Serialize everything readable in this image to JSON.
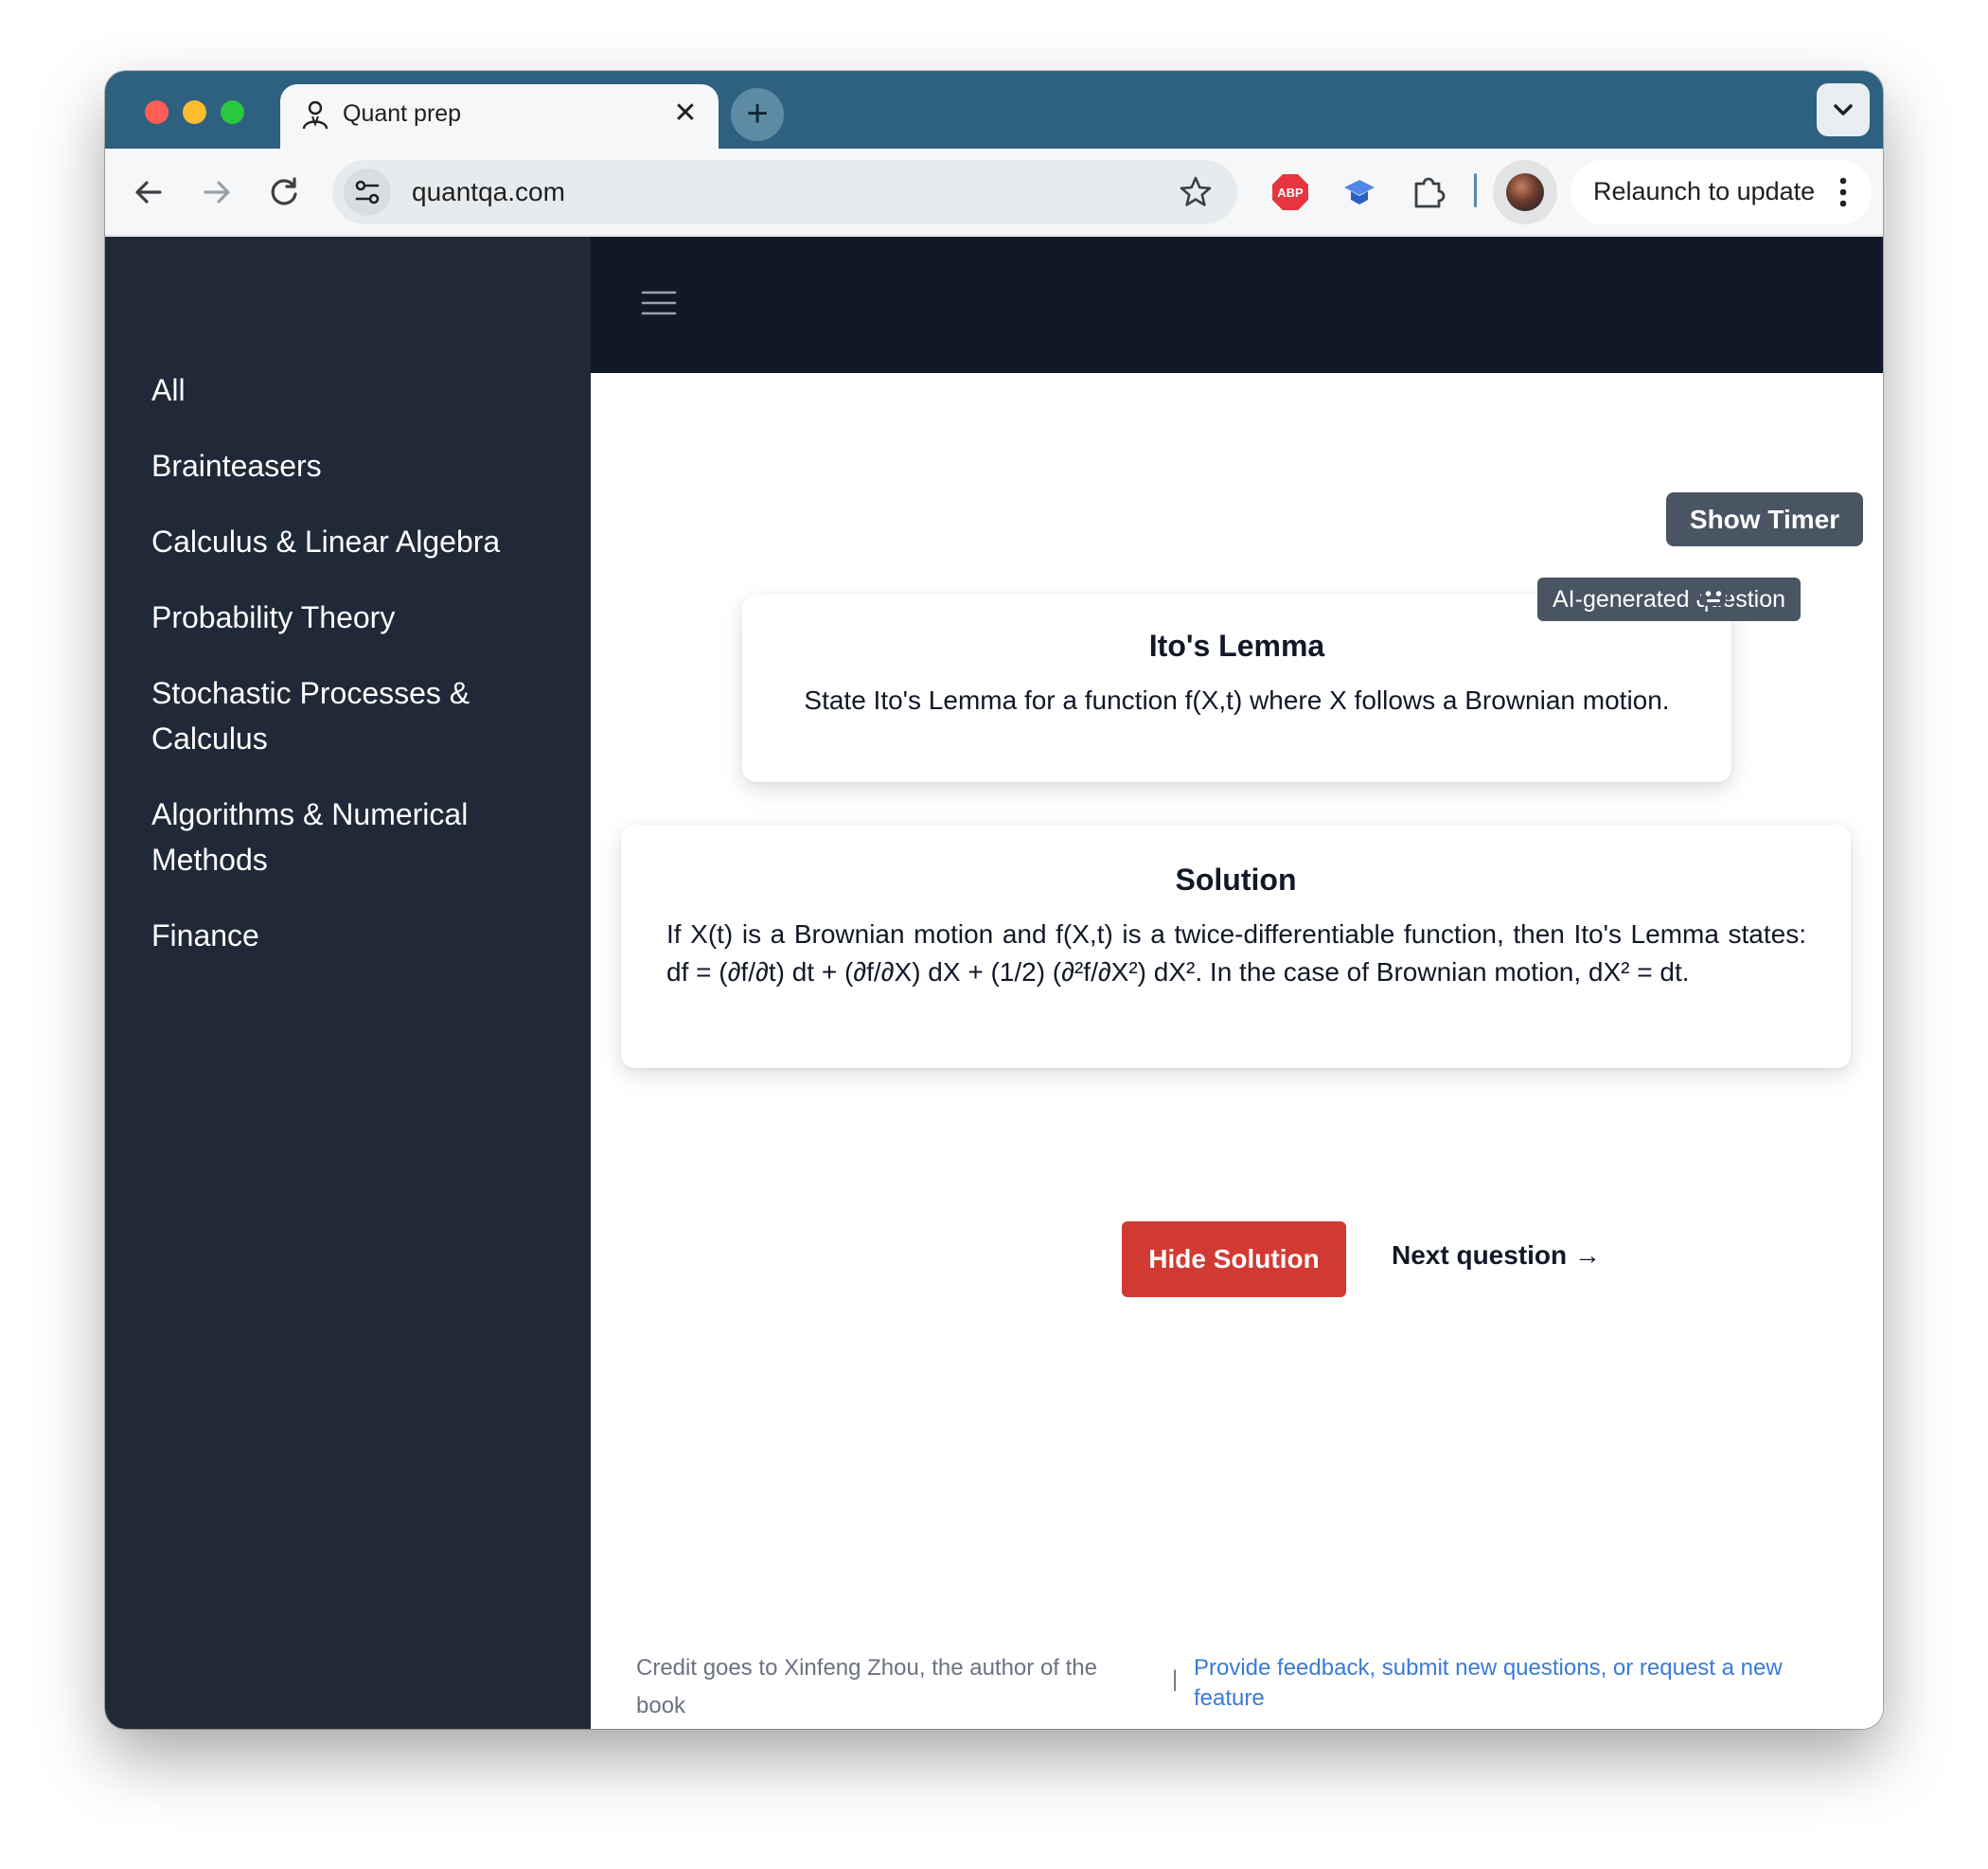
{
  "browser": {
    "tab_title": "Quant prep",
    "url": "quantqa.com",
    "relaunch_label": "Relaunch to update",
    "new_tab_symbol": "+",
    "close_symbol": "✕",
    "ext_abp_label": "ABP"
  },
  "sidebar": {
    "items": [
      {
        "label": "All"
      },
      {
        "label": "Brainteasers"
      },
      {
        "label": "Calculus & Linear Algebra"
      },
      {
        "label": "Probability Theory"
      },
      {
        "label": "Stochastic Processes & Calculus"
      },
      {
        "label": "Algorithms & Numerical Methods"
      },
      {
        "label": "Finance"
      }
    ]
  },
  "main": {
    "timer_label": "Show Timer",
    "ai_tooltip": "AI-generated question",
    "question": {
      "title": "Ito's Lemma",
      "text": "State Ito's Lemma for a function f(X,t) where X follows a Brownian motion."
    },
    "solution": {
      "title": "Solution",
      "text": "If X(t) is a Brownian motion and f(X,t) is a twice-differentiable function, then Ito's Lemma states: df = (∂f/∂t) dt + (∂f/∂X) dX + (1/2) (∂²f/∂X²) dX². In the case of Brownian motion, dX² = dt."
    },
    "hide_solution_label": "Hide Solution",
    "next_question_label": "Next question →"
  },
  "footer": {
    "credit": "Credit goes to Xinfeng Zhou, the author of the book",
    "separator": "|",
    "feedback_link": "Provide feedback, submit new questions, or request a new feature"
  },
  "colors": {
    "tabstrip": "#2e6180",
    "sidebar": "#202938",
    "topbar": "#111827",
    "timer_button": "#4a5563",
    "hide_button": "#d13a32",
    "link": "#3b7ad6"
  },
  "icons": {
    "tab": "quant-user-icon",
    "back": "arrow-left-icon",
    "forward": "arrow-right-icon",
    "reload": "reload-icon",
    "site_info": "tune-icon",
    "bookmark": "star-icon",
    "adblock": "abp-icon",
    "extension_2": "graduation-cap-icon",
    "extensions": "puzzle-icon",
    "menu": "hamburger-icon",
    "ai": "robot-icon"
  }
}
